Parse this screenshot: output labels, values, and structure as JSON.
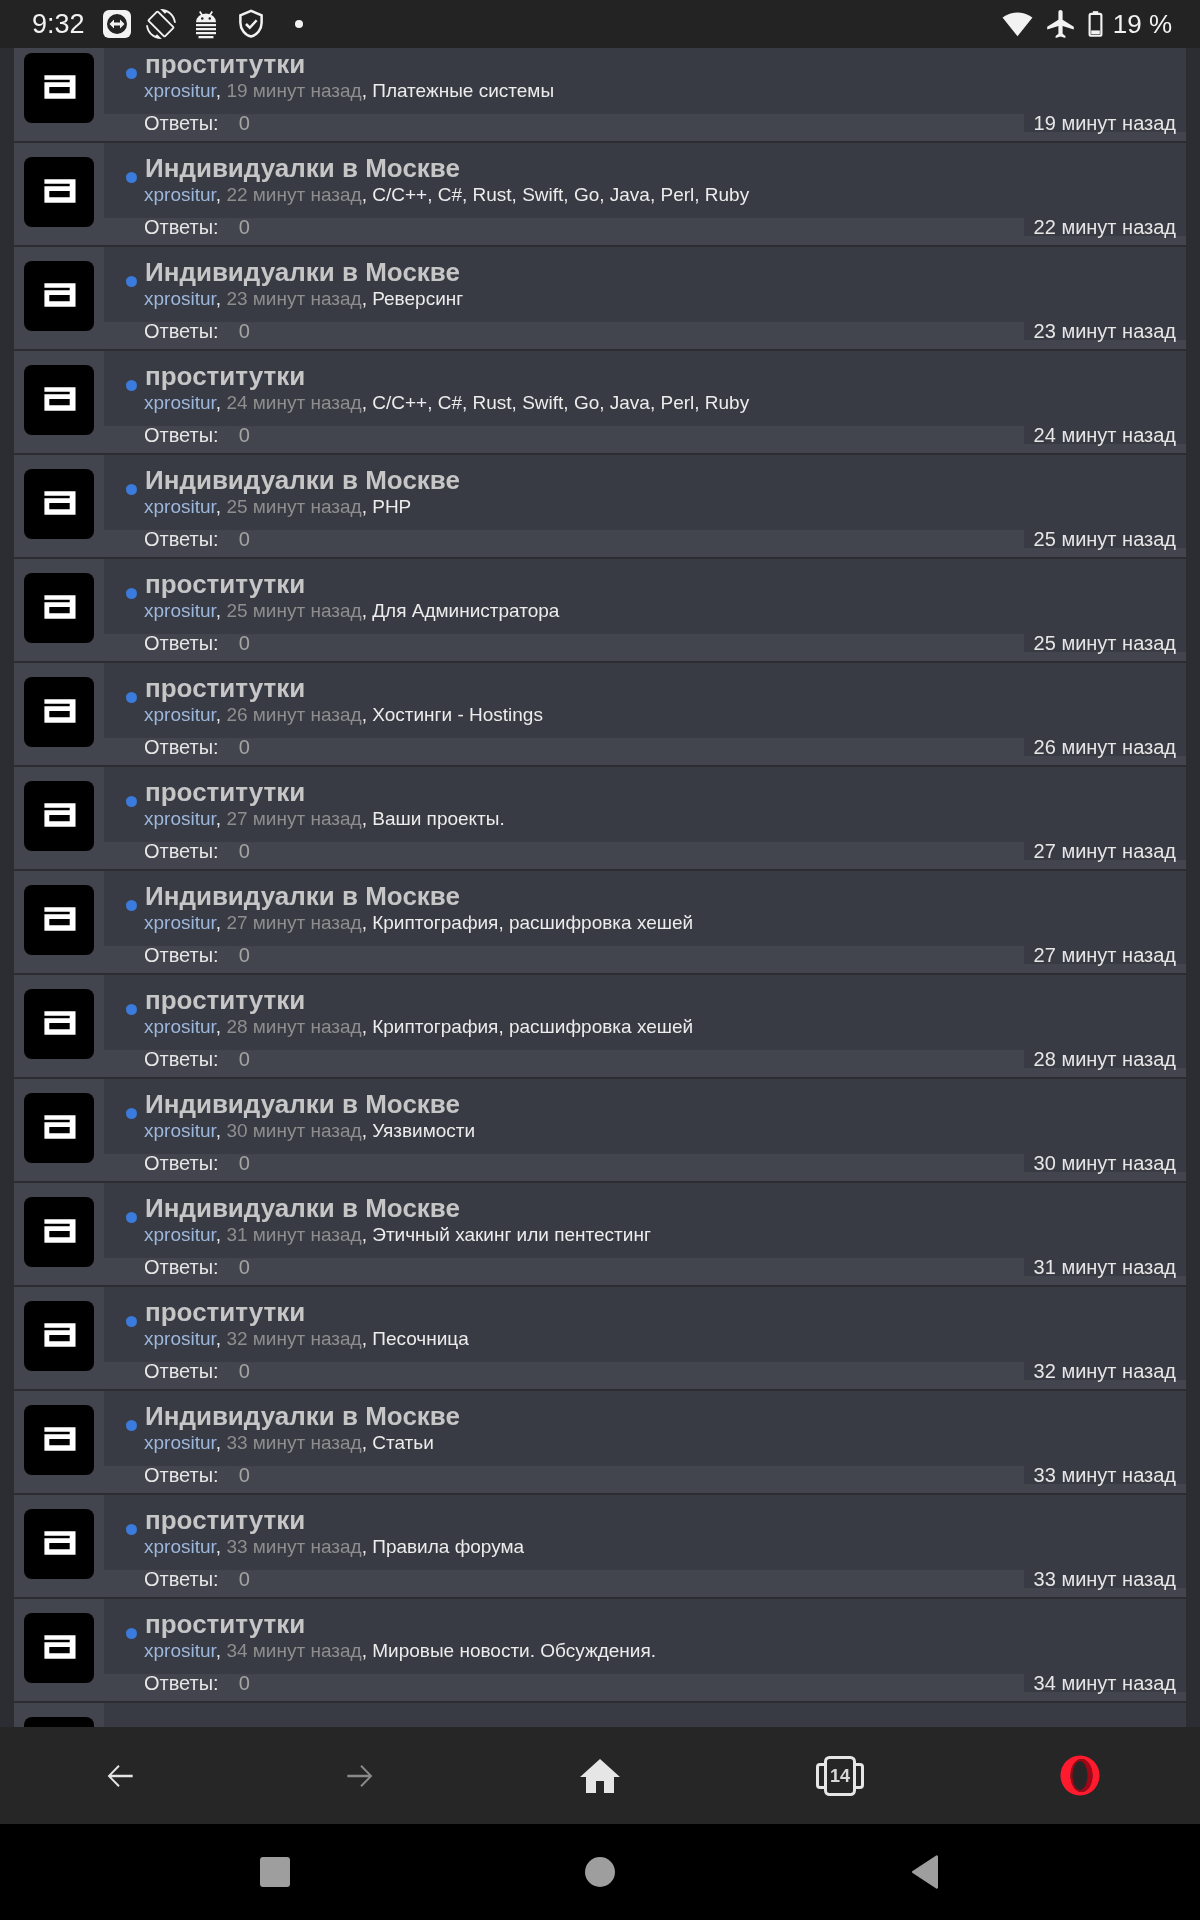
{
  "status_bar": {
    "time": "9:32",
    "battery": "19 %"
  },
  "topics": [
    {
      "kind": "topic",
      "unread": true,
      "title": "проститутки",
      "byline": [
        {
          "kind": "author",
          "text": "xprositur"
        },
        {
          "kind": "separator",
          "text": ", "
        },
        {
          "kind": "time",
          "text": "19 минут назад"
        },
        {
          "kind": "separator",
          "text": ", "
        },
        {
          "kind": "forum",
          "text": "Платежные системы"
        }
      ],
      "replies_label": "Ответы:",
      "replies": "0",
      "last_post": "19 минут назад"
    },
    {
      "kind": "topic",
      "unread": true,
      "title": "Индивидуалки в Москве",
      "byline": [
        {
          "kind": "author",
          "text": "xprositur"
        },
        {
          "kind": "separator",
          "text": ", "
        },
        {
          "kind": "time",
          "text": "22 минут назад"
        },
        {
          "kind": "separator",
          "text": ", "
        },
        {
          "kind": "forum",
          "text": "C/C++, C#, Rust, Swift, Go, Java, Perl, Ruby"
        }
      ],
      "replies_label": "Ответы:",
      "replies": "0",
      "last_post": "22 минут назад"
    },
    {
      "kind": "topic",
      "unread": true,
      "title": "Индивидуалки в Москве",
      "byline": [
        {
          "kind": "author",
          "text": "xprositur"
        },
        {
          "kind": "separator",
          "text": ", "
        },
        {
          "kind": "time",
          "text": "23 минут назад"
        },
        {
          "kind": "separator",
          "text": ", "
        },
        {
          "kind": "forum",
          "text": "Реверсинг"
        }
      ],
      "replies_label": "Ответы:",
      "replies": "0",
      "last_post": "23 минут назад"
    },
    {
      "kind": "topic",
      "unread": true,
      "title": "проститутки",
      "byline": [
        {
          "kind": "author",
          "text": "xprositur"
        },
        {
          "kind": "separator",
          "text": ", "
        },
        {
          "kind": "time",
          "text": "24 минут назад"
        },
        {
          "kind": "separator",
          "text": ", "
        },
        {
          "kind": "forum",
          "text": "C/C++, C#, Rust, Swift, Go, Java, Perl, Ruby"
        }
      ],
      "replies_label": "Ответы:",
      "replies": "0",
      "last_post": "24 минут назад"
    },
    {
      "kind": "topic",
      "unread": true,
      "title": "Индивидуалки в Москве",
      "byline": [
        {
          "kind": "author",
          "text": "xprositur"
        },
        {
          "kind": "separator",
          "text": ", "
        },
        {
          "kind": "time",
          "text": "25 минут назад"
        },
        {
          "kind": "separator",
          "text": ", "
        },
        {
          "kind": "forum",
          "text": "PHP"
        }
      ],
      "replies_label": "Ответы:",
      "replies": "0",
      "last_post": "25 минут назад"
    },
    {
      "kind": "topic",
      "unread": true,
      "title": "проститутки",
      "byline": [
        {
          "kind": "author",
          "text": "xprositur"
        },
        {
          "kind": "separator",
          "text": ", "
        },
        {
          "kind": "time",
          "text": "25 минут назад"
        },
        {
          "kind": "separator",
          "text": ", "
        },
        {
          "kind": "forum",
          "text": "Для Администратора"
        }
      ],
      "replies_label": "Ответы:",
      "replies": "0",
      "last_post": "25 минут назад"
    },
    {
      "kind": "topic",
      "unread": true,
      "title": "проститутки",
      "byline": [
        {
          "kind": "author",
          "text": "xprositur"
        },
        {
          "kind": "separator",
          "text": ", "
        },
        {
          "kind": "time",
          "text": "26 минут назад"
        },
        {
          "kind": "separator",
          "text": ", "
        },
        {
          "kind": "forum",
          "text": "Хостинги - Hostings"
        }
      ],
      "replies_label": "Ответы:",
      "replies": "0",
      "last_post": "26 минут назад"
    },
    {
      "kind": "topic",
      "unread": true,
      "title": "проститутки",
      "byline": [
        {
          "kind": "author",
          "text": "xprositur"
        },
        {
          "kind": "separator",
          "text": ", "
        },
        {
          "kind": "time",
          "text": "27 минут назад"
        },
        {
          "kind": "separator",
          "text": ", "
        },
        {
          "kind": "forum",
          "text": "Ваши проекты."
        }
      ],
      "replies_label": "Ответы:",
      "replies": "0",
      "last_post": "27 минут назад"
    },
    {
      "kind": "topic",
      "unread": true,
      "title": "Индивидуалки в Москве",
      "byline": [
        {
          "kind": "author",
          "text": "xprositur"
        },
        {
          "kind": "separator",
          "text": ", "
        },
        {
          "kind": "time",
          "text": "27 минут назад"
        },
        {
          "kind": "separator",
          "text": ", "
        },
        {
          "kind": "forum",
          "text": "Криптография, расшифровка хешей"
        }
      ],
      "replies_label": "Ответы:",
      "replies": "0",
      "last_post": "27 минут назад"
    },
    {
      "kind": "topic",
      "unread": true,
      "title": "проститутки",
      "byline": [
        {
          "kind": "author",
          "text": "xprositur"
        },
        {
          "kind": "separator",
          "text": ", "
        },
        {
          "kind": "time",
          "text": "28 минут назад"
        },
        {
          "kind": "separator",
          "text": ", "
        },
        {
          "kind": "forum",
          "text": "Криптография, расшифровка хешей"
        }
      ],
      "replies_label": "Ответы:",
      "replies": "0",
      "last_post": "28 минут назад"
    },
    {
      "kind": "topic",
      "unread": true,
      "title": "Индивидуалки в Москве",
      "byline": [
        {
          "kind": "author",
          "text": "xprositur"
        },
        {
          "kind": "separator",
          "text": ", "
        },
        {
          "kind": "time",
          "text": "30 минут назад"
        },
        {
          "kind": "separator",
          "text": ", "
        },
        {
          "kind": "forum",
          "text": "Уязвимости"
        }
      ],
      "replies_label": "Ответы:",
      "replies": "0",
      "last_post": "30 минут назад"
    },
    {
      "kind": "topic",
      "unread": true,
      "title": "Индивидуалки в Москве",
      "byline": [
        {
          "kind": "author",
          "text": "xprositur"
        },
        {
          "kind": "separator",
          "text": ", "
        },
        {
          "kind": "time",
          "text": "31 минут назад"
        },
        {
          "kind": "separator",
          "text": ", "
        },
        {
          "kind": "forum",
          "text": "Этичный хакинг или пентестинг"
        }
      ],
      "replies_label": "Ответы:",
      "replies": "0",
      "last_post": "31 минут назад"
    },
    {
      "kind": "topic",
      "unread": true,
      "title": "проститутки",
      "byline": [
        {
          "kind": "author",
          "text": "xprositur"
        },
        {
          "kind": "separator",
          "text": ", "
        },
        {
          "kind": "time",
          "text": "32 минут назад"
        },
        {
          "kind": "separator",
          "text": ", "
        },
        {
          "kind": "forum",
          "text": "Песочница"
        }
      ],
      "replies_label": "Ответы:",
      "replies": "0",
      "last_post": "32 минут назад"
    },
    {
      "kind": "topic",
      "unread": true,
      "title": "Индивидуалки в Москве",
      "byline": [
        {
          "kind": "author",
          "text": "xprositur"
        },
        {
          "kind": "separator",
          "text": ", "
        },
        {
          "kind": "time",
          "text": "33 минут назад"
        },
        {
          "kind": "separator",
          "text": ", "
        },
        {
          "kind": "forum",
          "text": "Статьи"
        }
      ],
      "replies_label": "Ответы:",
      "replies": "0",
      "last_post": "33 минут назад"
    },
    {
      "kind": "topic",
      "unread": true,
      "title": "проститутки",
      "byline": [
        {
          "kind": "author",
          "text": "xprositur"
        },
        {
          "kind": "separator",
          "text": ", "
        },
        {
          "kind": "time",
          "text": "33 минут назад"
        },
        {
          "kind": "separator",
          "text": ", "
        },
        {
          "kind": "forum",
          "text": "Правила форума"
        }
      ],
      "replies_label": "Ответы:",
      "replies": "0",
      "last_post": "33 минут назад"
    },
    {
      "kind": "topic",
      "unread": true,
      "title": "проститутки",
      "byline": [
        {
          "kind": "author",
          "text": "xprositur"
        },
        {
          "kind": "separator",
          "text": ", "
        },
        {
          "kind": "time",
          "text": "34 минут назад"
        },
        {
          "kind": "separator",
          "text": ", "
        },
        {
          "kind": "forum",
          "text": "Мировые новости. Обсуждения."
        }
      ],
      "replies_label": "Ответы:",
      "replies": "0",
      "last_post": "34 минут назад"
    },
    {
      "kind": "cut"
    }
  ],
  "toolbar": [
    {
      "kind": "back",
      "disabled": false
    },
    {
      "kind": "forward",
      "disabled": true
    },
    {
      "kind": "home",
      "disabled": false
    },
    {
      "kind": "tabs",
      "disabled": false,
      "count": "14"
    },
    {
      "kind": "menu",
      "disabled": false
    }
  ]
}
